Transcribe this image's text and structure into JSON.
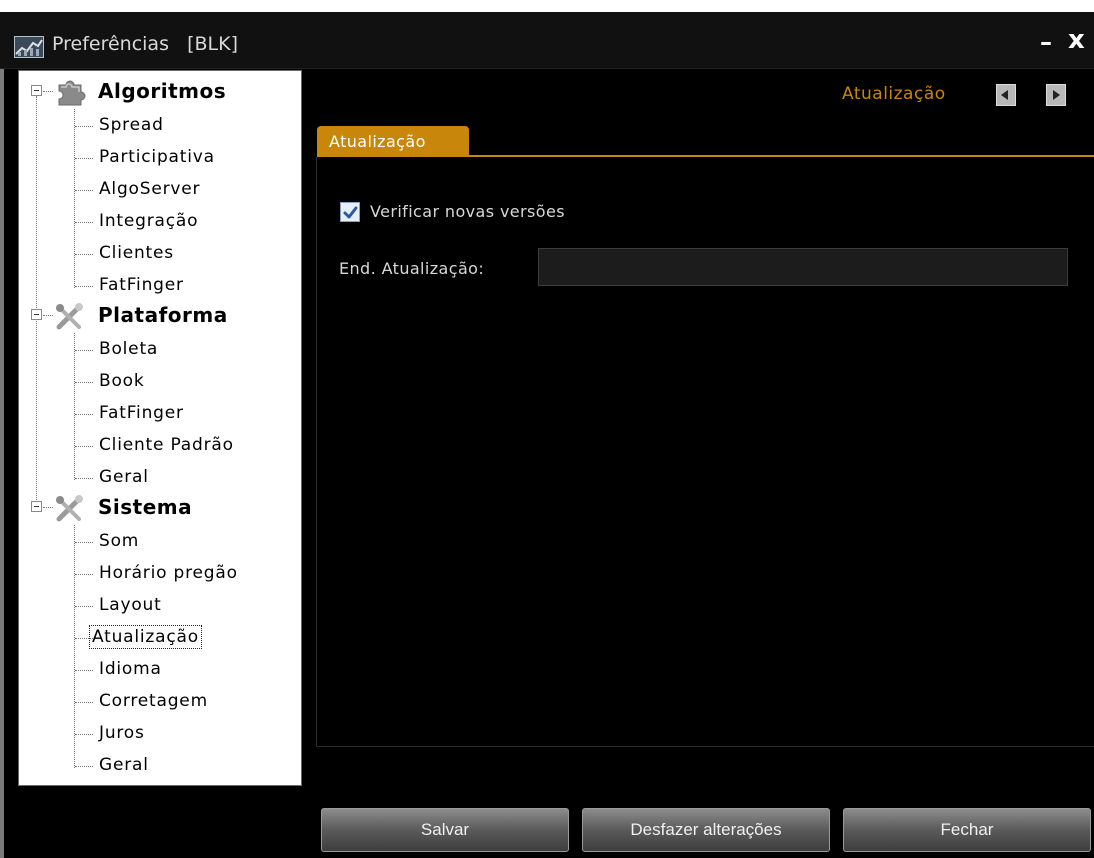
{
  "window": {
    "title": "Preferências   [BLK]",
    "minimize": "–",
    "close": "x"
  },
  "tree": {
    "categories": [
      {
        "label": "Algoritmos",
        "icon": "puzzle-icon",
        "items": [
          "Spread",
          "Participativa",
          "AlgoServer",
          "Integração",
          "Clientes",
          "FatFinger"
        ]
      },
      {
        "label": "Plataforma",
        "icon": "tools-icon",
        "items": [
          "Boleta",
          "Book",
          "FatFinger",
          "Cliente Padrão",
          "Geral"
        ]
      },
      {
        "label": "Sistema",
        "icon": "tools-icon",
        "items": [
          "Som",
          "Horário pregão",
          "Layout",
          "Atualização",
          "Idioma",
          "Corretagem",
          "Juros",
          "Geral"
        ]
      }
    ],
    "selected": "Atualização"
  },
  "section": {
    "title": "Atualização",
    "tab_label": "Atualização"
  },
  "form": {
    "check_updates_label": "Verificar novas versões",
    "check_updates_checked": true,
    "update_address_label": "End. Atualização:",
    "update_address_value": ""
  },
  "buttons": {
    "save": "Salvar",
    "undo": "Desfazer alterações",
    "close": "Fechar"
  },
  "colors": {
    "accent": "#c8860a",
    "background": "#000000"
  }
}
